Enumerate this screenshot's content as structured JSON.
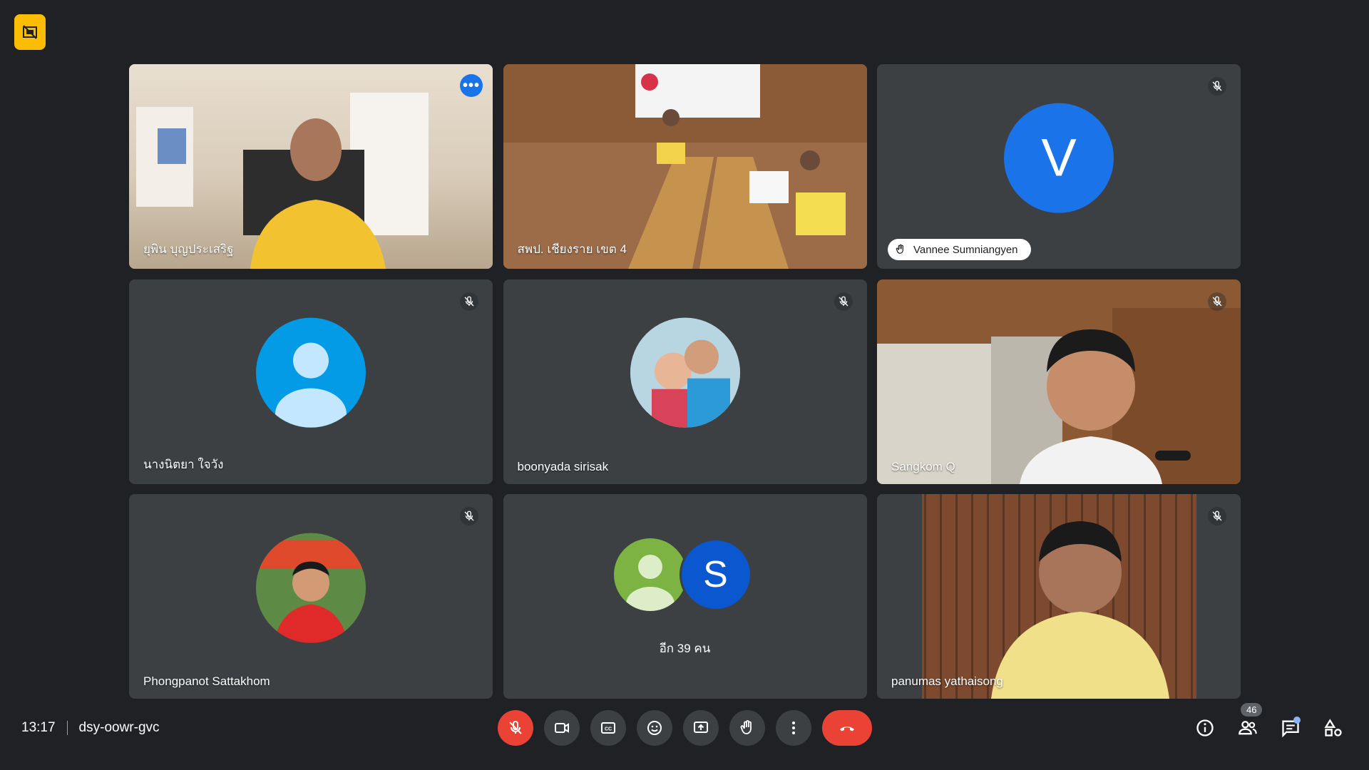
{
  "meeting": {
    "time": "13:17",
    "code": "dsy-oowr-gvc"
  },
  "participants_count": "46",
  "tiles": {
    "t1": {
      "name": "ยุพิน บุญประเสริฐ"
    },
    "t2": {
      "name": "สพป. เชียงราย เขต 4"
    },
    "t3": {
      "name": "Vannee Sumniangyen",
      "initial": "V"
    },
    "t4": {
      "name": "นางนิตยา ใจวัง"
    },
    "t5": {
      "name": "boonyada sirisak"
    },
    "t6": {
      "name": "Sangkom Q"
    },
    "t7": {
      "name": "Phongpanot Sattakhom"
    },
    "t8": {
      "initial": "S",
      "more_label": "อีก 39 คน"
    },
    "t9": {
      "name": "panumas yathaisong"
    }
  },
  "colors": {
    "background": "#202124",
    "tile": "#3c4043",
    "accent_blue": "#1a73e8",
    "end_call_red": "#ea4335",
    "badge_yellow": "#fbbc04"
  }
}
